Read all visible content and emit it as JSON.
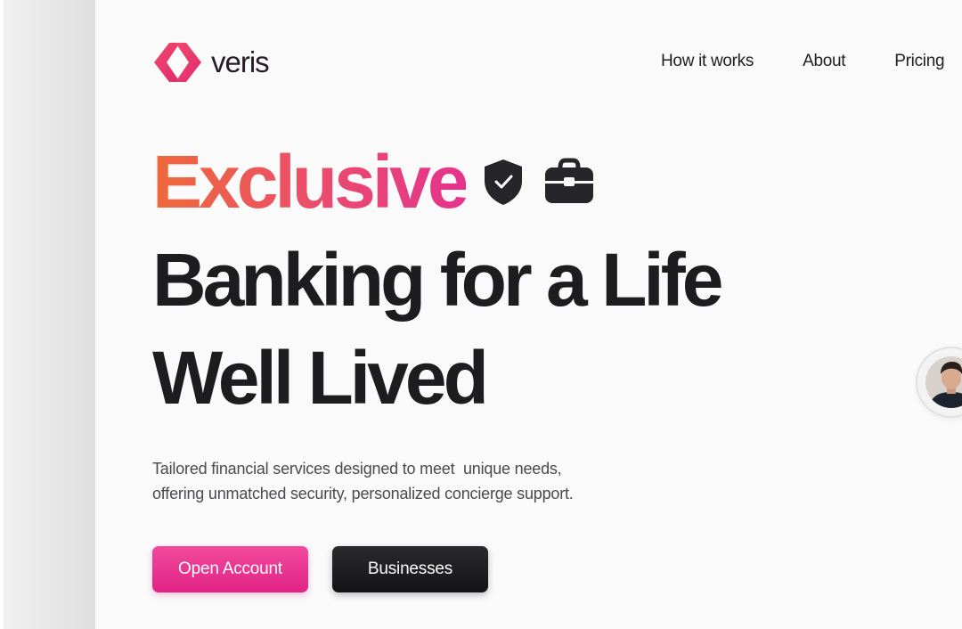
{
  "brand": {
    "name": "veris",
    "logo_colors": [
      "#f0386f",
      "#e02b74"
    ]
  },
  "nav": {
    "items": [
      "How it works",
      "About",
      "Pricing"
    ]
  },
  "hero": {
    "highlight": "Exclusive",
    "line2": "Banking for a Life",
    "line3": "Well Lived",
    "icons": [
      "shield-check-icon",
      "briefcase-icon"
    ]
  },
  "subtitle": {
    "line1": "Tailored financial services designed to meet  unique needs,",
    "line2": "offering unmatched security, personalized concierge support."
  },
  "buttons": {
    "primary": "Open Account",
    "secondary": "Businesses"
  },
  "colors": {
    "accent_pink": "#e22386",
    "accent_orange": "#ef6a3a",
    "text_dark": "#1d1d20"
  }
}
